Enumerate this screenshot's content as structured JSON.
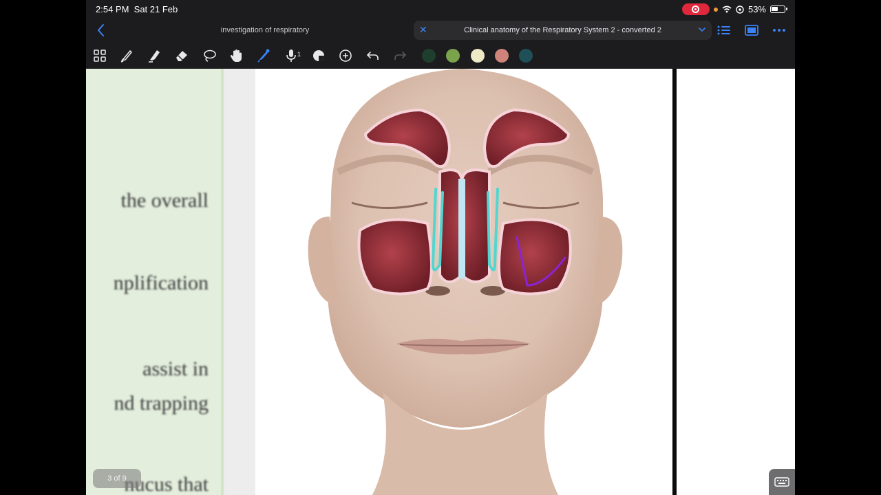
{
  "status_bar": {
    "time": "2:54 PM",
    "date": "Sat 21 Feb",
    "battery": "53%"
  },
  "nav": {
    "document_title": "investigation of respiratory",
    "tab_title": "Clinical anatomy of the Respiratory System 2 - converted 2"
  },
  "toolbar": {
    "mic_count": "1",
    "colors": [
      "#1e3f2e",
      "#7aa34c",
      "#eeeac6",
      "#d0837b",
      "#1f4f57"
    ]
  },
  "page": {
    "left_text_lines": [
      "the overall",
      "nplification",
      "assist in",
      "nd trapping",
      "nucus that"
    ],
    "indicator": "3 of 9"
  },
  "accent_color": "#3a82f7"
}
